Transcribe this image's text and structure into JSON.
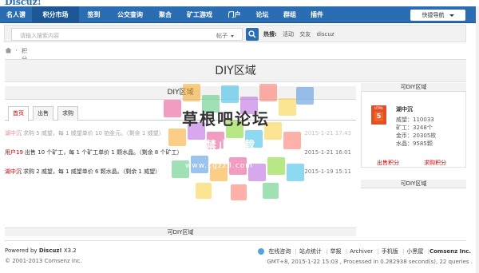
{
  "header": {
    "logo_text": "Discuz!",
    "nav_items": [
      "名人谱",
      "积分市场",
      "签到",
      "公交查询",
      "聚合",
      "矿工游戏",
      "门户",
      "论坛",
      "群组",
      "插件"
    ],
    "active_index": 1,
    "quick_nav": "快捷导航"
  },
  "search": {
    "placeholder": "请输入搜索内容",
    "scope": "帖子",
    "hot_label": "热搜:",
    "hot_keywords": [
      "活动",
      "交友",
      "discuz"
    ]
  },
  "breadcrumb": {
    "separator": "›",
    "current": "积分市场"
  },
  "diy": {
    "main": "DIY区域",
    "sub": "DIY区域",
    "footer": "可DIY区域",
    "right_top": "可DIY区域",
    "right_bottom": "可DIY区域"
  },
  "tabs": [
    "首页",
    "出售",
    "求购"
  ],
  "active_tab": 0,
  "rows": [
    {
      "user": "湖中沉",
      "text": "求购 5 威望，每 1 威望单价 10 铂金元。（剩余 1 威望）",
      "time": "2015-1-21 17:43",
      "faded": true
    },
    {
      "user": "用户19",
      "text": "出售 10 个矿工，每 1 个矿工单价 1 颗水晶。（剩余 8 个矿工）",
      "time": "2015-1-21 16:01",
      "faded": false
    },
    {
      "user": "湖中沉",
      "text": "求购 2 威望，每 1 威望单价 6 颗水晶。（剩余 1 威望）",
      "time": "2015-1-19 15:11",
      "faded": false
    }
  ],
  "user_card": {
    "avatar_label": "HTML",
    "avatar_num": "5",
    "name": "湖中沉",
    "stats": [
      "威望：110033",
      "矿工：3248个",
      "金币：20305枚",
      "水晶：9585颗"
    ],
    "sell_label": "出售积分",
    "buy_label": "求购积分"
  },
  "footer": {
    "powered": "Powered by",
    "brand": "Discuz!",
    "version": "X3.2",
    "copyright": "© 2001-2013 Comsenz Inc.",
    "links": [
      "在线咨询",
      "站点统计",
      "举报",
      "Archiver",
      "手机版",
      "小黑屋"
    ],
    "company": "Comsenz Inc.",
    "gmt": "GMT+8, 2015-1-22 15:03 , Processed in 0.282938 second(s), 22 queries ."
  },
  "watermark": {
    "title": "草根吧论坛",
    "subtitle": "禁止转载",
    "url": "www.cgzz8.com"
  },
  "colors": {
    "nav": "#2b6db3",
    "nav_active": "#1d5796",
    "accent_red": "#cc0000",
    "panel_gray": "#f2f2f2"
  }
}
